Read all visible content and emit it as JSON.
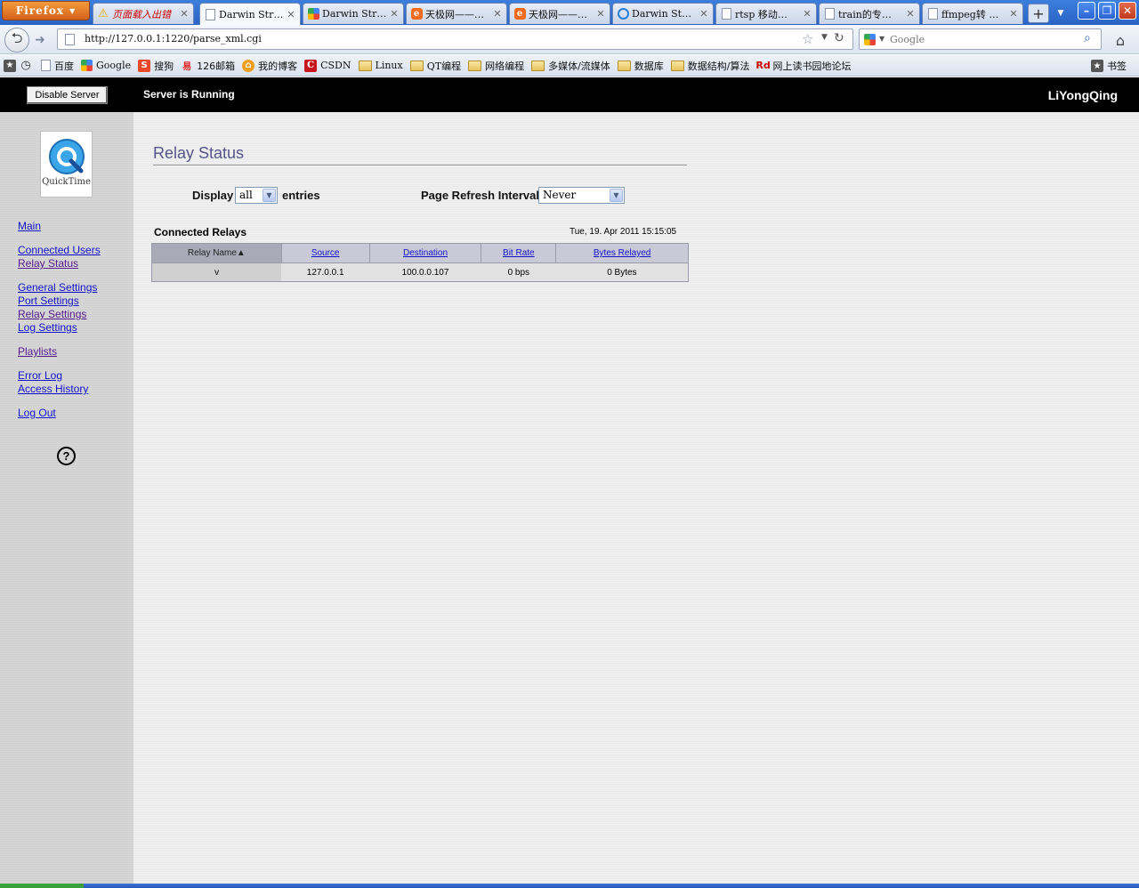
{
  "browser": {
    "menu_button": "Firefox",
    "tabs": [
      {
        "title": "页面载入出错",
        "icon": "warning-icon",
        "warn": true
      },
      {
        "title": "Darwin Str…",
        "icon": "page-icon",
        "active": true
      },
      {
        "title": "Darwin Str…",
        "icon": "google-icon"
      },
      {
        "title": "天极网——…",
        "icon": "ie-icon"
      },
      {
        "title": "天极网——…",
        "icon": "ie-icon"
      },
      {
        "title": "Darwin  St…",
        "icon": "quicktime-icon"
      },
      {
        "title": "rtsp 移动…",
        "icon": "page-icon"
      },
      {
        "title": "train的专…",
        "icon": "page-icon"
      },
      {
        "title": "ffmpeg转 …",
        "icon": "page-icon"
      }
    ],
    "url": "http://127.0.0.1:1220/parse_xml.cgi",
    "search_placeholder": "Google",
    "bookmarks": [
      {
        "label": "百度",
        "icon": "page-icon"
      },
      {
        "label": "Google",
        "icon": "google-icon"
      },
      {
        "label": "搜狗",
        "icon": "sogou-icon"
      },
      {
        "label": "126邮箱",
        "icon": "mail126-icon"
      },
      {
        "label": "我的博客",
        "icon": "blog-icon"
      },
      {
        "label": "CSDN",
        "icon": "csdn-icon"
      },
      {
        "label": "Linux",
        "icon": "folder-icon"
      },
      {
        "label": "QT编程",
        "icon": "folder-icon"
      },
      {
        "label": "网络编程",
        "icon": "folder-icon"
      },
      {
        "label": "多媒体/流媒体",
        "icon": "folder-icon"
      },
      {
        "label": "数据库",
        "icon": "folder-icon"
      },
      {
        "label": "数据结构/算法",
        "icon": "folder-icon"
      },
      {
        "label": "网上读书园地论坛",
        "icon": "rd-icon"
      }
    ],
    "bookmarks_menu": "书签"
  },
  "topbar": {
    "disable_button": "Disable Server",
    "status": "Server is Running",
    "user": "LiYongQing"
  },
  "sidebar": {
    "logo_text": "QuickTime",
    "links": [
      {
        "label": "Main"
      },
      {
        "label": "Connected Users"
      },
      {
        "label": "Relay Status",
        "visited": true
      },
      {
        "label": "General Settings"
      },
      {
        "label": "Port Settings"
      },
      {
        "label": "Relay Settings",
        "visited": true
      },
      {
        "label": "Log Settings"
      },
      {
        "label": "Playlists",
        "visited": true
      },
      {
        "label": "Error Log"
      },
      {
        "label": "Access History"
      },
      {
        "label": "Log Out"
      }
    ],
    "help_glyph": "?"
  },
  "main": {
    "title": "Relay Status",
    "display_label": "Display",
    "display_value": "all",
    "entries_label": "entries",
    "refresh_label": "Page Refresh Interval:",
    "refresh_value": "Never",
    "table_caption": "Connected Relays",
    "timestamp": "Tue, 19. Apr 2011 15:15:05",
    "columns": [
      "Relay Name▲",
      "Source",
      "Destination",
      "Bit Rate",
      "Bytes Relayed"
    ],
    "rows": [
      [
        "v",
        "127.0.0.1",
        "100.0.0.107",
        "0 bps",
        "0 Bytes"
      ]
    ]
  }
}
